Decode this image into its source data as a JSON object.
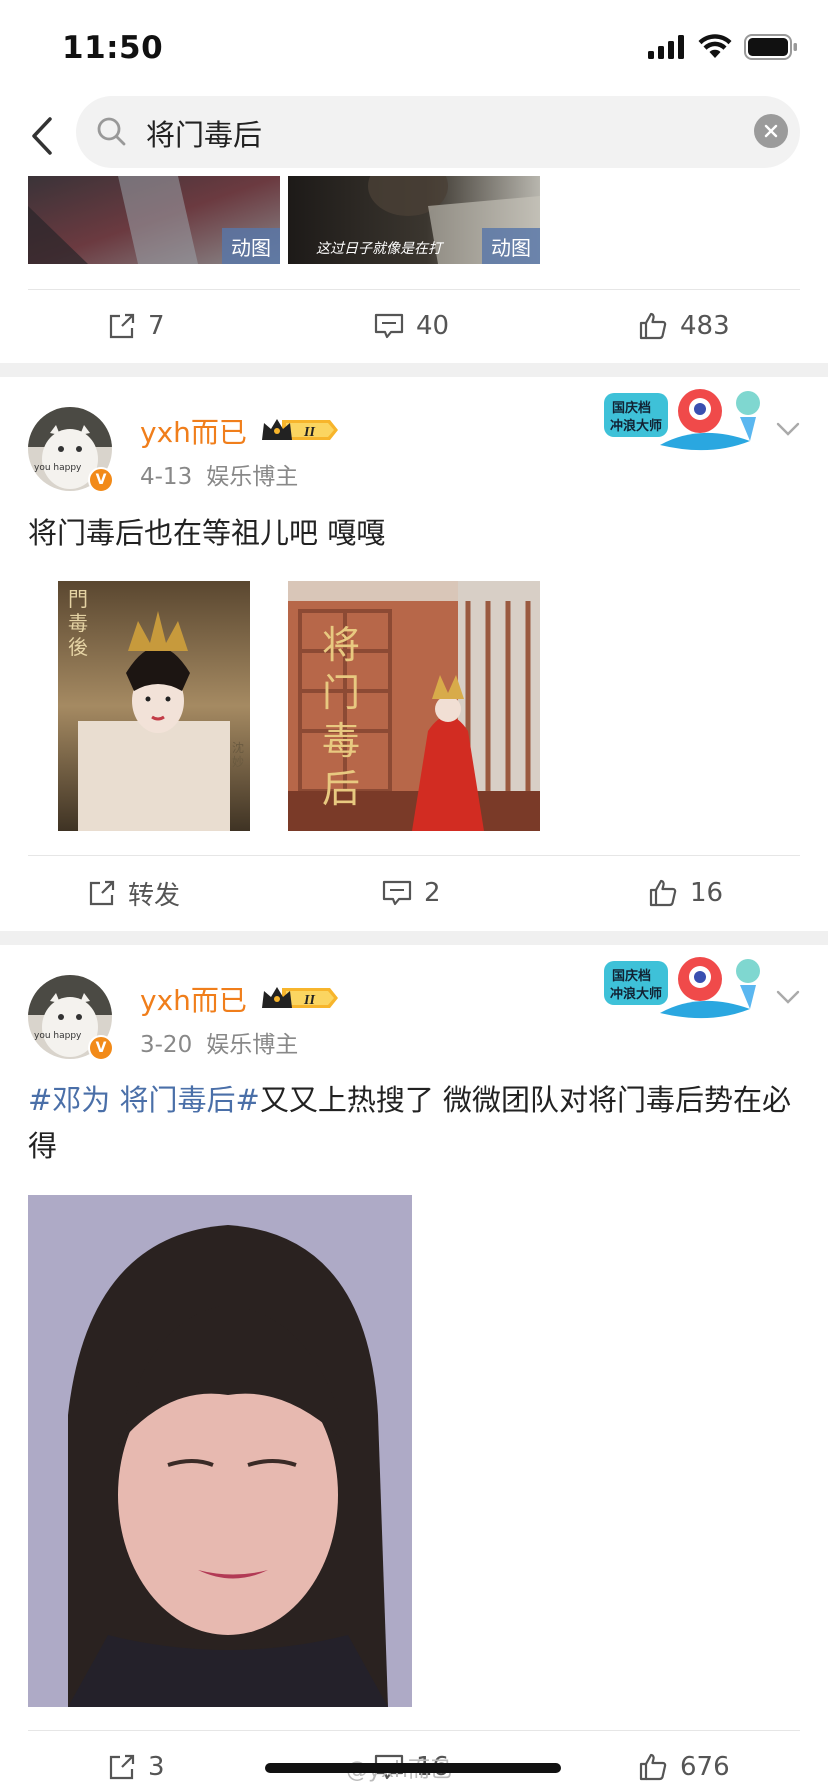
{
  "status_bar": {
    "time": "11:50"
  },
  "search": {
    "query": "将门毒后"
  },
  "top_strip": {
    "badge1": "动图",
    "badge2": "动图",
    "caption2": "这过日子就像是在打"
  },
  "post0_actions": {
    "repost": "7",
    "comment": "40",
    "like": "483"
  },
  "post1": {
    "username": "yxh而已",
    "vip_level": "II",
    "date": "4-13",
    "category": "娱乐博主",
    "text": "将门毒后也在等祖儿吧 嘎嘎",
    "campaign_line1": "国庆档",
    "campaign_line2": "冲浪大师",
    "avatar_text": "you happy",
    "photo1_text": "門毒後",
    "photo1_sig": "沈妙",
    "photo2_text": "将门毒后",
    "actions": {
      "repost": "转发",
      "comment": "2",
      "like": "16"
    }
  },
  "post2": {
    "username": "yxh而已",
    "vip_level": "II",
    "date": "3-20",
    "category": "娱乐博主",
    "hashtag": "#邓为 将门毒后#",
    "text_rest": "又又上热搜了 微微团队对将门毒后势在必得",
    "campaign_line1": "国庆档",
    "campaign_line2": "冲浪大师",
    "avatar_text": "you happy",
    "actions": {
      "repost": "3",
      "comment": "16",
      "like": "676"
    }
  },
  "watermark": "@yxh而已",
  "colors": {
    "username": "#f07e1b",
    "hashtag": "#4a6fa8",
    "badge": "#f28a18"
  }
}
